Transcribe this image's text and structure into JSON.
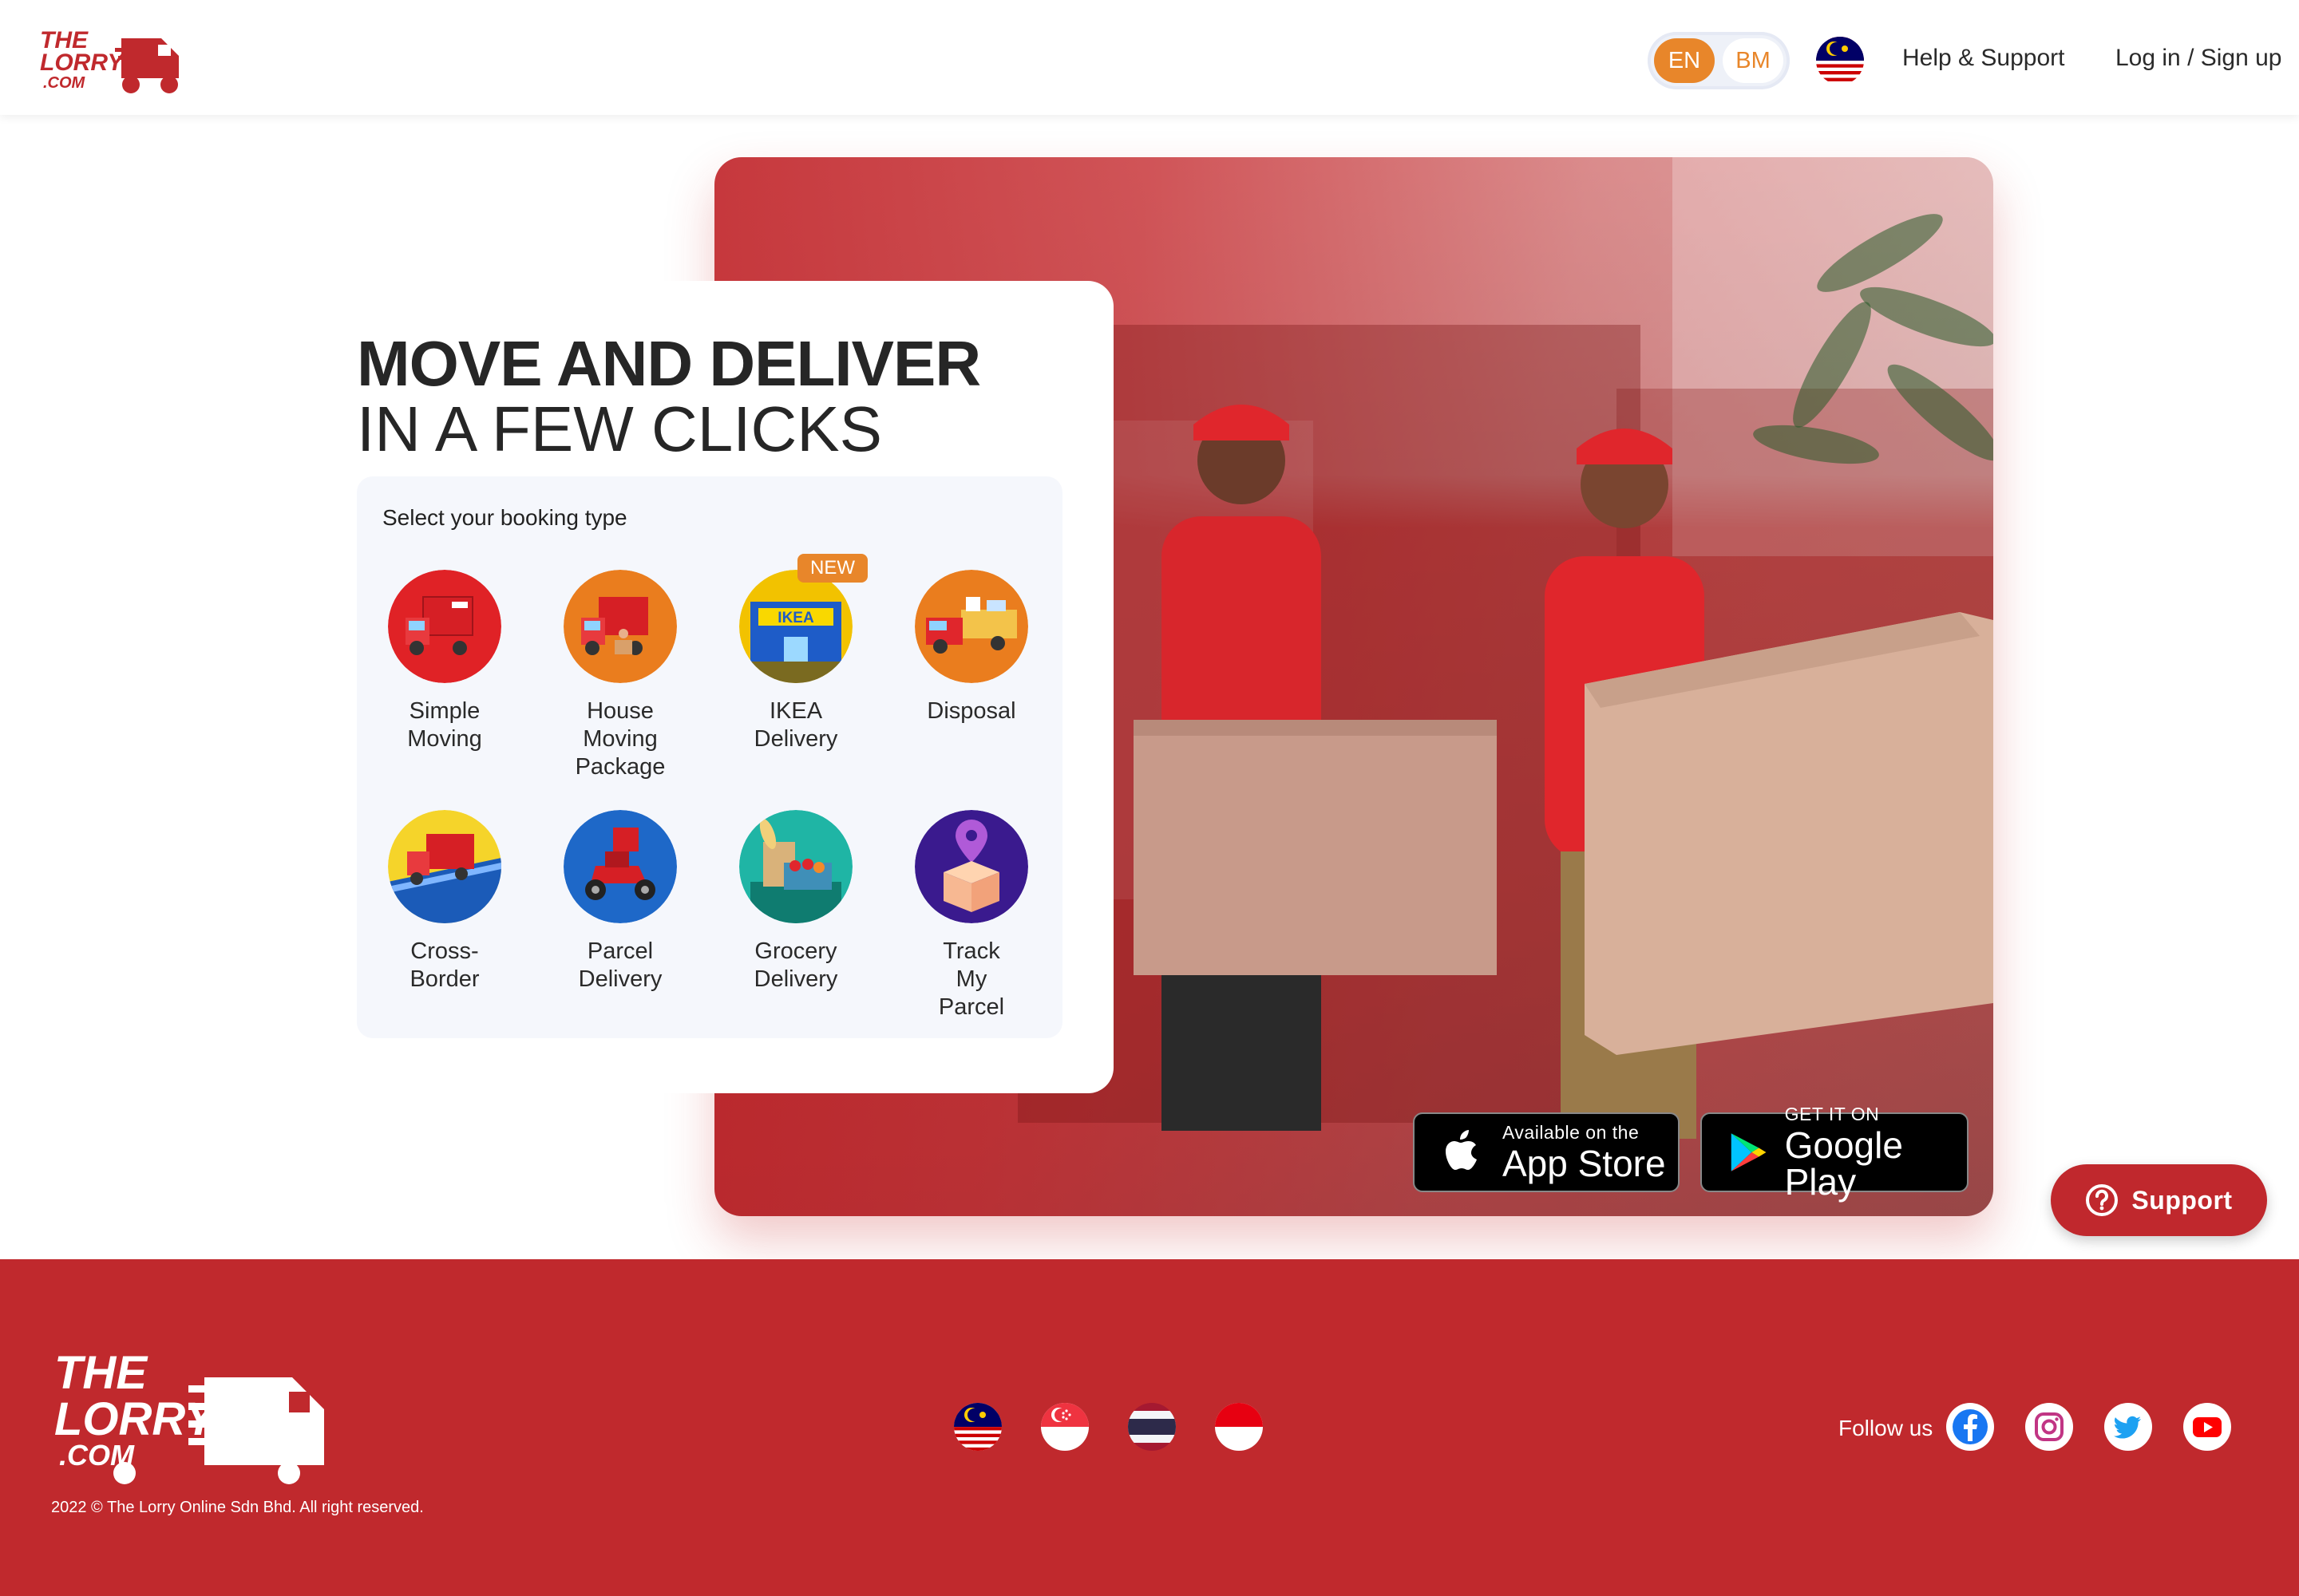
{
  "header": {
    "logo_text": "THE LORRY .COM",
    "lang": {
      "en": "EN",
      "bm": "BM",
      "selected": "EN"
    },
    "help_label": "Help & Support",
    "login_label": "Log in / Sign up"
  },
  "hero": {
    "headline_bold": "MOVE AND DELIVER",
    "headline_light": "IN A FEW CLICKS",
    "booking_label": "Select your booking type",
    "new_badge": "NEW",
    "booking_types": [
      {
        "label": "Simple\nMoving",
        "icon": "red-lorry-icon"
      },
      {
        "label": "House\nMoving\nPackage",
        "icon": "house-moving-icon"
      },
      {
        "label": "IKEA\nDelivery",
        "icon": "ikea-store-icon"
      },
      {
        "label": "Disposal",
        "icon": "disposal-truck-icon"
      },
      {
        "label": "Cross-\nBorder",
        "icon": "cross-border-icon"
      },
      {
        "label": "Parcel\nDelivery",
        "icon": "scooter-icon"
      },
      {
        "label": "Grocery\nDelivery",
        "icon": "grocery-basket-icon"
      },
      {
        "label": "Track\nMy\nParcel",
        "icon": "location-pin-parcel-icon"
      }
    ],
    "app_store": {
      "small": "Available on the",
      "big": "App Store"
    },
    "google_play": {
      "small": "GET IT ON",
      "big": "Google Play"
    }
  },
  "support": {
    "label": "Support"
  },
  "footer": {
    "copyright": "2022 © The Lorry Online Sdn Bhd. All right reserved.",
    "countries": [
      "malaysia-flag",
      "singapore-flag",
      "thailand-flag",
      "indonesia-flag"
    ],
    "follow_label": "Follow us",
    "socials": [
      "facebook-icon",
      "instagram-icon",
      "twitter-icon",
      "youtube-icon"
    ]
  },
  "colors": {
    "brand_red": "#c0292d",
    "accent_orange": "#e8862a",
    "panel_bg": "#f5f7fc"
  }
}
